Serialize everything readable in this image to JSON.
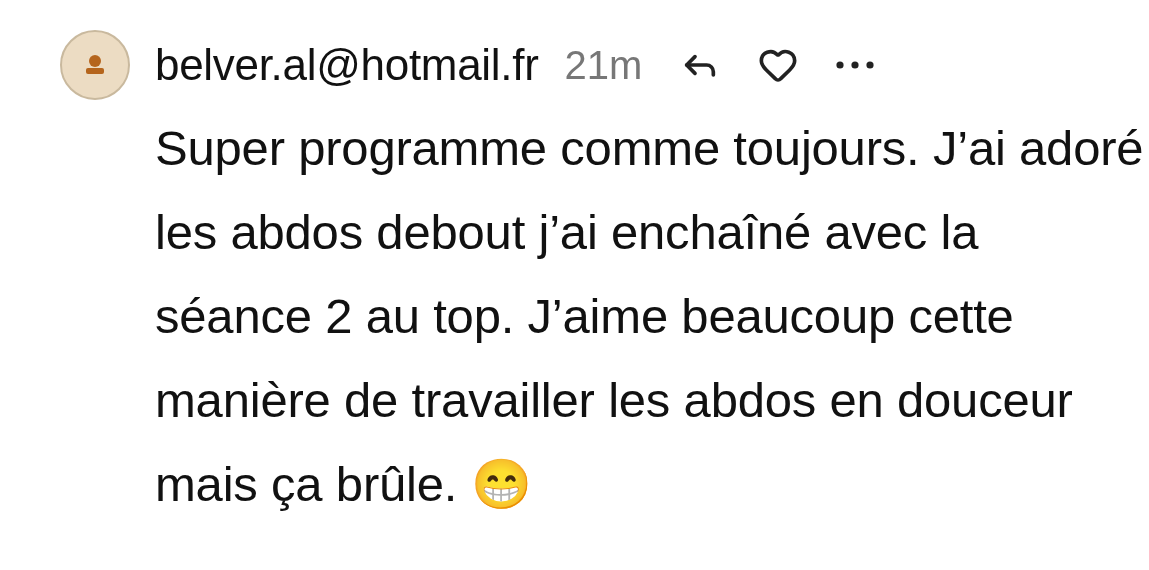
{
  "comment": {
    "author": "belver.al@hotmail.fr",
    "time": "21m",
    "liked": false,
    "text": "Super programme comme toujours. J’ai adoré les abdos debout j’ai enchaîné avec la séance 2 au top. J’aime beaucoup cette manière de travailler les abdos en douceur mais ça brûle. 😁"
  }
}
